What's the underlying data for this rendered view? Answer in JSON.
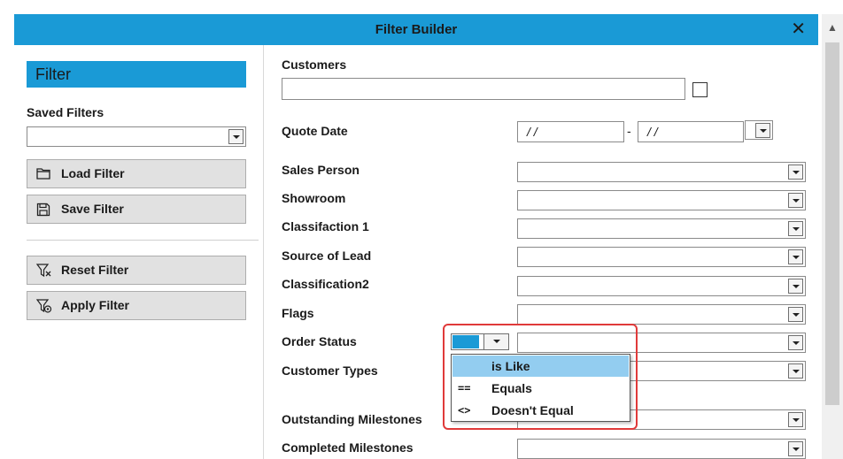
{
  "dialog": {
    "title": "Filter Builder",
    "close_glyph": "✕"
  },
  "sidebar": {
    "heading": "Filter",
    "saved_filters_label": "Saved Filters",
    "saved_filters_value": "",
    "buttons": {
      "load": "Load Filter",
      "save": "Save Filter",
      "reset": "Reset Filter",
      "apply": "Apply Filter"
    }
  },
  "form": {
    "customers_label": "Customers",
    "customers_value": "",
    "quote_date_label": "Quote Date",
    "quote_date_from": "/ /",
    "quote_date_sep": "-",
    "quote_date_to": "/ /",
    "sales_person_label": "Sales Person",
    "showroom_label": "Showroom",
    "classification1_label": "Classifaction 1",
    "source_of_lead_label": "Source of Lead",
    "classification2_label": "Classification2",
    "flags_label": "Flags",
    "order_status_label": "Order Status",
    "customer_types_label": "Customer Types",
    "outstanding_milestones_label": "Outstanding Milestones",
    "completed_milestones_label": "Completed Milestones"
  },
  "operator_dropdown": {
    "options": [
      {
        "symbol": "",
        "label": "is Like",
        "selected": true
      },
      {
        "symbol": "==",
        "label": "Equals",
        "selected": false
      },
      {
        "symbol": "<>",
        "label": "Doesn't Equal",
        "selected": false
      }
    ]
  },
  "colors": {
    "accent": "#1a9ad6",
    "selection": "#93cdf0",
    "highlight_border": "#e03a3a"
  },
  "icons": [
    "close-icon",
    "folder-icon",
    "save-icon",
    "filter-reset-icon",
    "filter-apply-icon",
    "chevron-down-icon",
    "scroll-up-icon"
  ]
}
